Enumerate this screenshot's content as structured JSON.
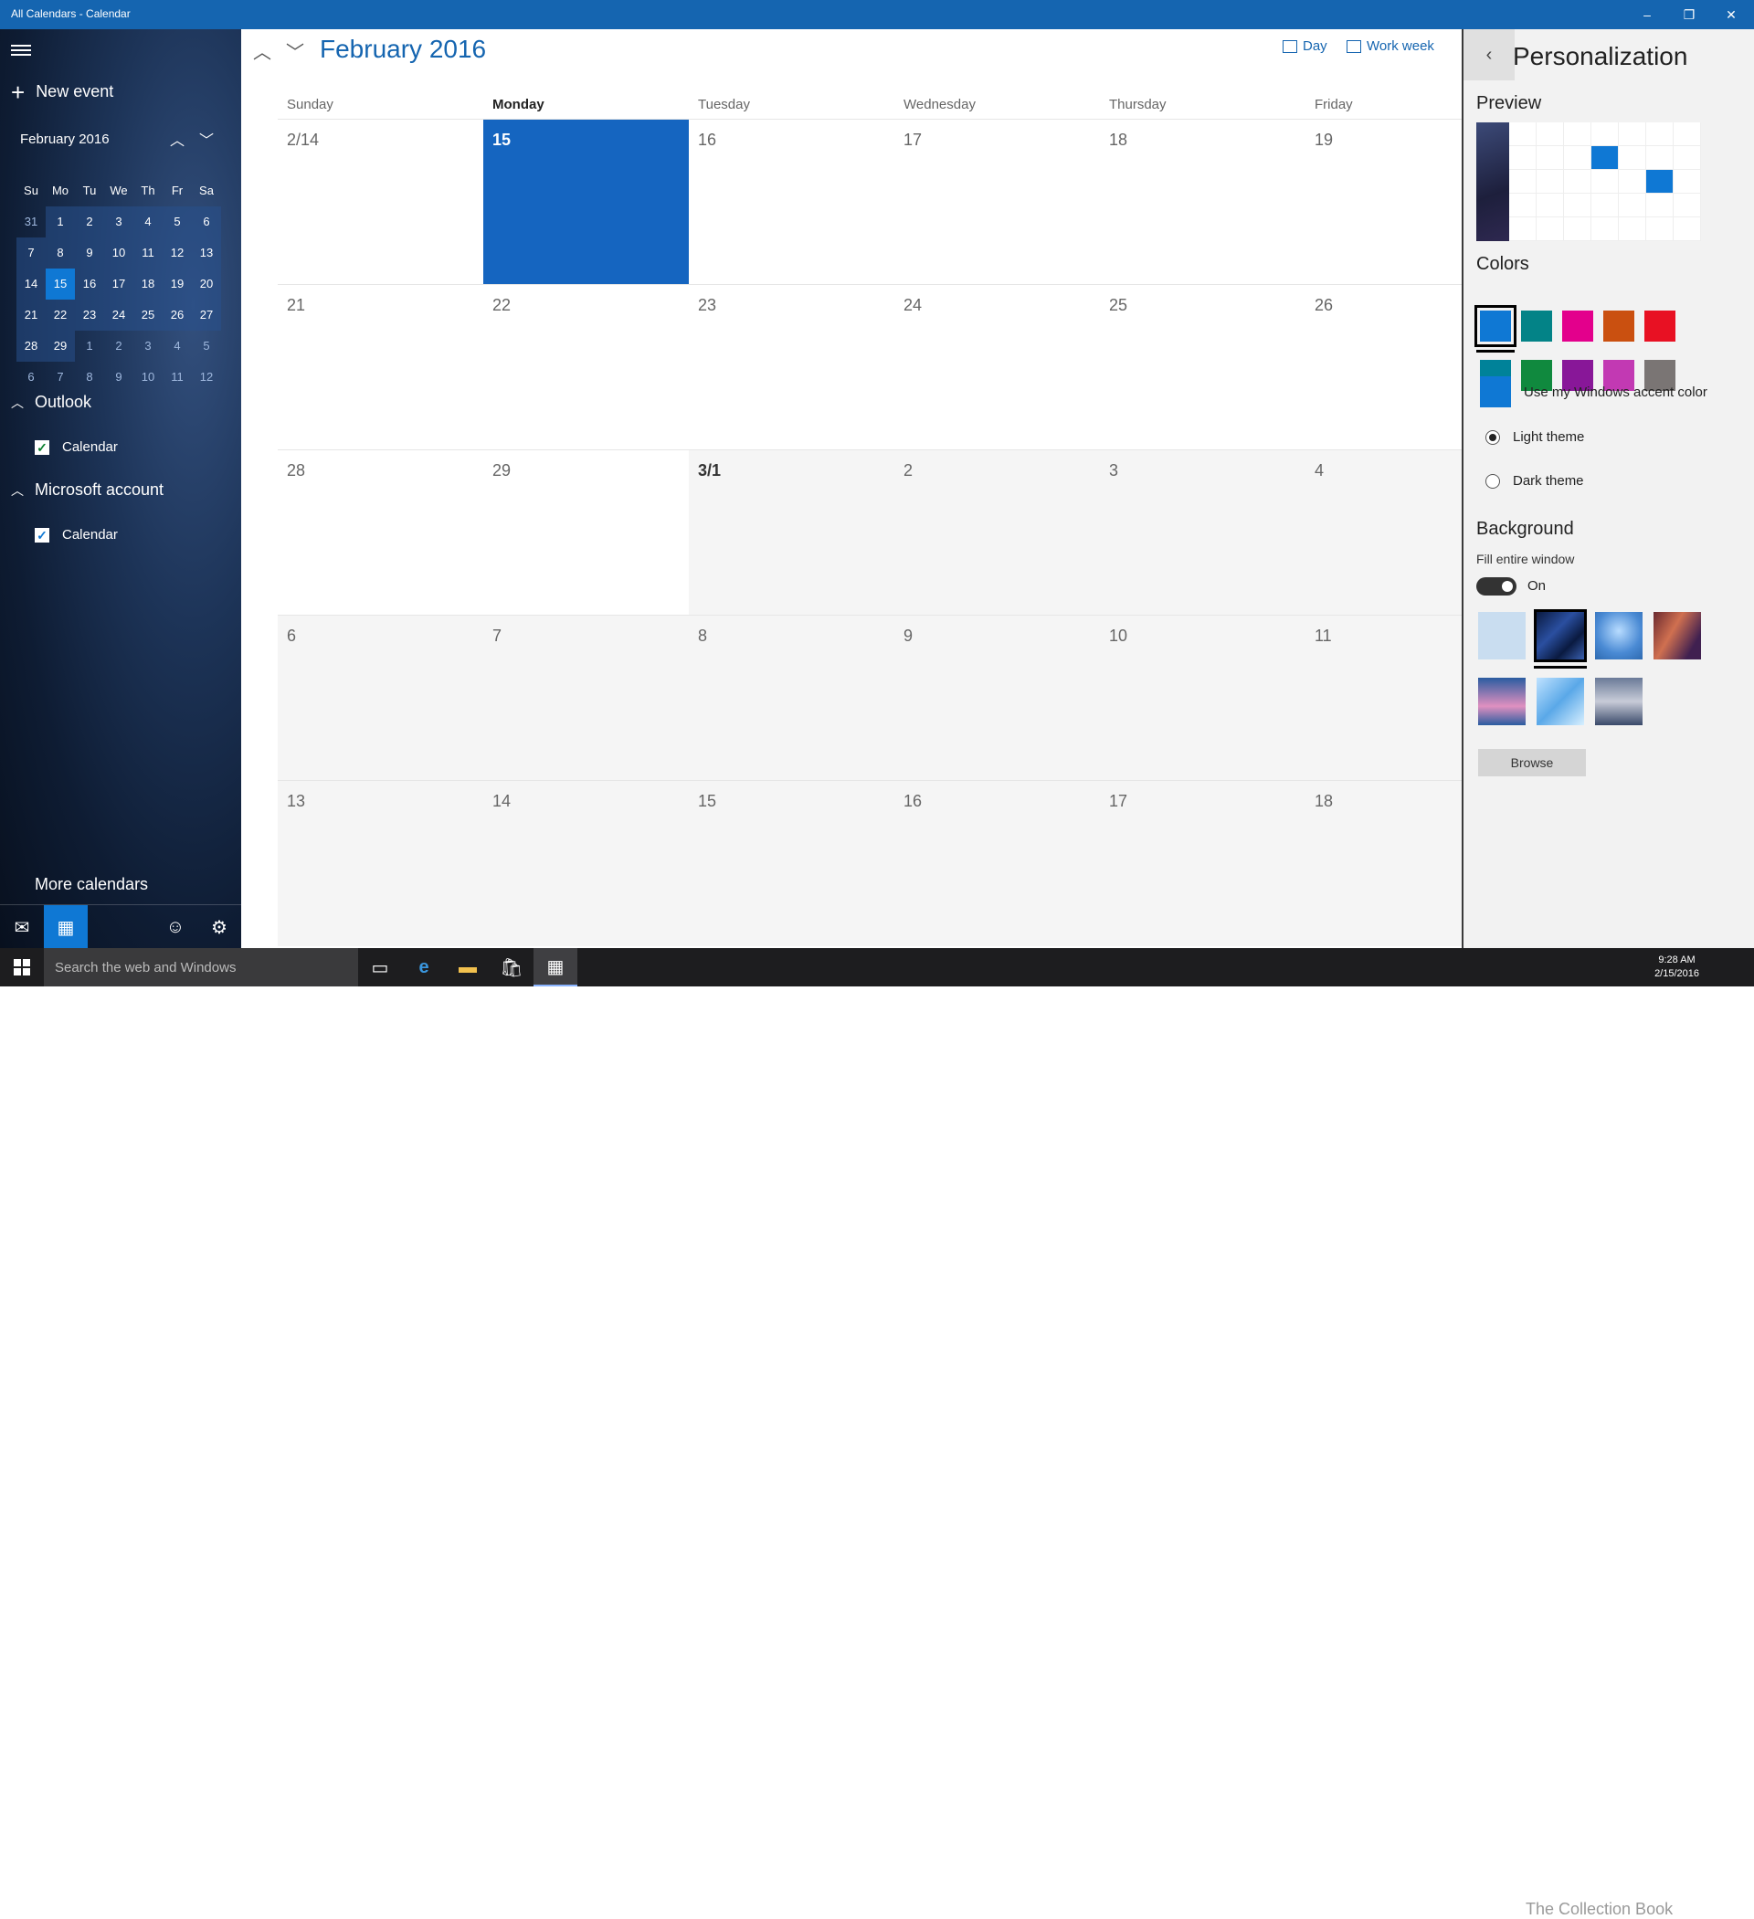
{
  "window": {
    "title": "All Calendars - Calendar",
    "minimize": "–",
    "restore": "❐",
    "close": "✕"
  },
  "sidebar": {
    "new_event": "New event",
    "mini": {
      "month_label": "February 2016",
      "days_header": [
        "Su",
        "Mo",
        "Tu",
        "We",
        "Th",
        "Fr",
        "Sa"
      ],
      "weeks": [
        [
          "31",
          "1",
          "2",
          "3",
          "4",
          "5",
          "6"
        ],
        [
          "7",
          "8",
          "9",
          "10",
          "11",
          "12",
          "13"
        ],
        [
          "14",
          "15",
          "16",
          "17",
          "18",
          "19",
          "20"
        ],
        [
          "21",
          "22",
          "23",
          "24",
          "25",
          "26",
          "27"
        ],
        [
          "28",
          "29",
          "1",
          "2",
          "3",
          "4",
          "5"
        ],
        [
          "6",
          "7",
          "8",
          "9",
          "10",
          "11",
          "12"
        ]
      ],
      "today": "15"
    },
    "groups": [
      {
        "name": "Outlook",
        "calendar": "Calendar"
      },
      {
        "name": "Microsoft account",
        "calendar": "Calendar"
      }
    ],
    "more_calendars": "More calendars"
  },
  "main": {
    "month_title": "February 2016",
    "views": [
      "Day",
      "Work week"
    ],
    "weekdays": [
      "Sunday",
      "Monday",
      "Tuesday",
      "Wednesday",
      "Thursday",
      "Friday"
    ],
    "weeks": [
      [
        "2/14",
        "15",
        "16",
        "17",
        "18",
        "19"
      ],
      [
        "21",
        "22",
        "23",
        "24",
        "25",
        "26"
      ],
      [
        "28",
        "29",
        "3/1",
        "2",
        "3",
        "4"
      ],
      [
        "6",
        "7",
        "8",
        "9",
        "10",
        "11"
      ],
      [
        "13",
        "14",
        "15",
        "16",
        "17",
        "18"
      ]
    ]
  },
  "panel": {
    "title": "Personalization",
    "preview_label": "Preview",
    "colors_label": "Colors",
    "colors": [
      "#0f78d4",
      "#038387",
      "#e3008c",
      "#ca5010",
      "#e81123",
      "#008299",
      "#10893e",
      "#881798",
      "#c239b3",
      "#7a7574"
    ],
    "accent_label": "Use my Windows accent color",
    "light_theme": "Light theme",
    "dark_theme": "Dark theme",
    "background_label": "Background",
    "fill_entire_window": "Fill entire window",
    "toggle_state": "On",
    "browse": "Browse"
  },
  "taskbar": {
    "search_placeholder": "Search the web and Windows",
    "time": "9:28 AM",
    "date": "2/15/2016",
    "watermark": "The Collection Book"
  }
}
